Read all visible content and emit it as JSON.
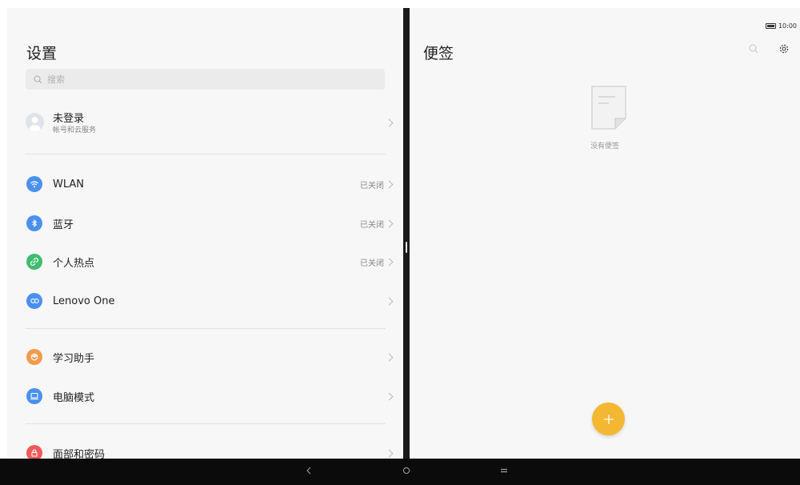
{
  "settings": {
    "title": "设置",
    "search_placeholder": "搜索",
    "account": {
      "name": "未登录",
      "sub": "帐号和云服务"
    },
    "items": [
      {
        "label": "WLAN",
        "status": "已关闭",
        "icon": "wifi-icon",
        "color": "#4a90f0"
      },
      {
        "label": "蓝牙",
        "status": "已关闭",
        "icon": "bluetooth-icon",
        "color": "#4a90f0"
      },
      {
        "label": "个人热点",
        "status": "已关闭",
        "icon": "hotspot-icon",
        "color": "#3fbd6e"
      },
      {
        "label": "Lenovo One",
        "status": "",
        "icon": "lenovo-one-icon",
        "color": "#4a90f0"
      },
      {
        "label": "学习助手",
        "status": "",
        "icon": "study-assistant-icon",
        "color": "#f39a4b"
      },
      {
        "label": "电脑模式",
        "status": "",
        "icon": "pc-mode-icon",
        "color": "#4a90f0"
      },
      {
        "label": "面部和密码",
        "status": "",
        "icon": "lock-icon",
        "color": "#f05a5a"
      }
    ]
  },
  "notes": {
    "title": "便签",
    "empty_text": "没有便签",
    "fab_color": "#f4b731"
  },
  "status_bar": {
    "time": "10:00"
  }
}
